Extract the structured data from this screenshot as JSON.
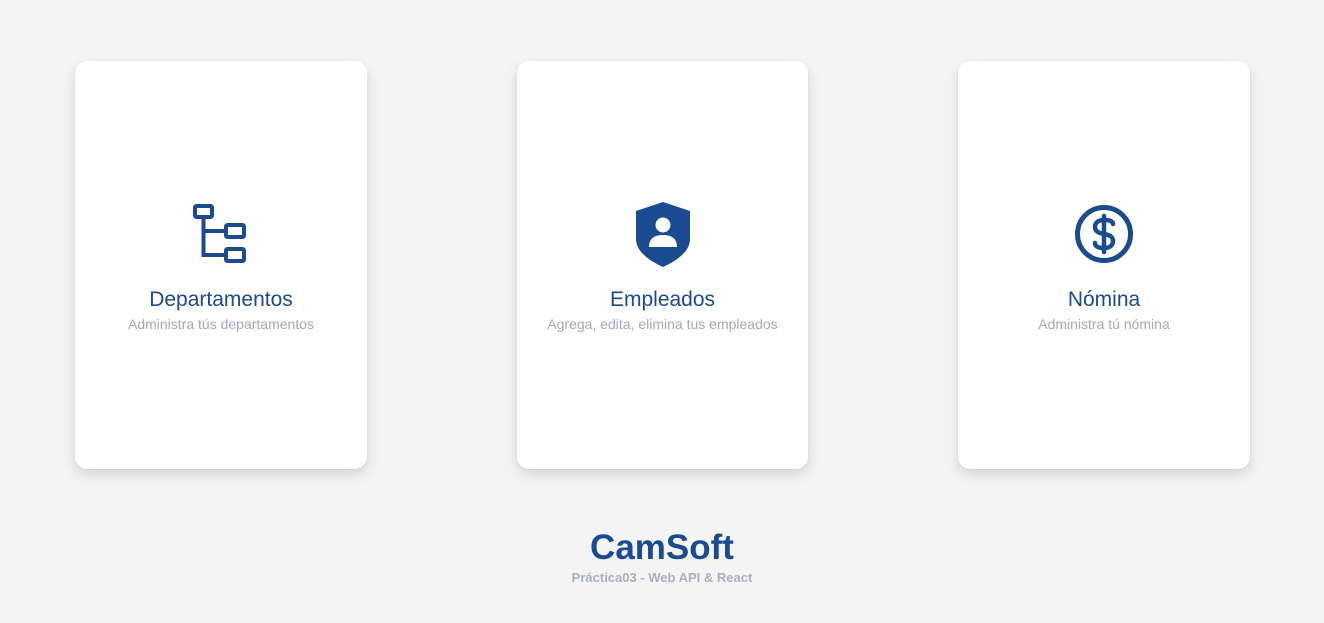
{
  "colors": {
    "background": "#f4f4f4",
    "card": "#ffffff",
    "accent": "#1a4a8f",
    "muted_text": "#a2a9b6"
  },
  "cards": [
    {
      "icon": "org-chart-icon",
      "title": "Departamentos",
      "subtitle": "Administra tús departamentos"
    },
    {
      "icon": "user-shield-icon",
      "title": "Empleados",
      "subtitle": "Agrega, edita, elimina tus empleados"
    },
    {
      "icon": "dollar-circle-icon",
      "title": "Nómina",
      "subtitle": "Administra tú nómina"
    }
  ],
  "footer": {
    "brand": "CamSoft",
    "tagline": "Práctica03 - Web API & React"
  }
}
